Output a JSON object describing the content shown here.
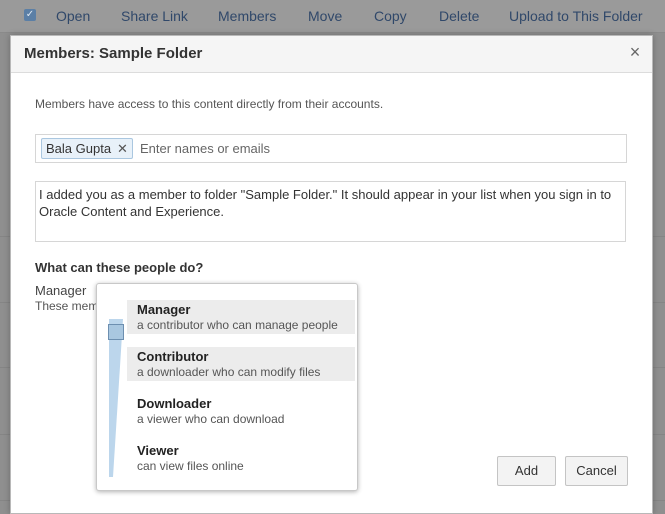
{
  "toolbar": {
    "items": [
      "Open",
      "Share Link",
      "Members",
      "Move",
      "Copy",
      "Delete",
      "Upload to This Folder"
    ]
  },
  "dialog": {
    "title": "Members: Sample Folder",
    "close_glyph": "×",
    "description": "Members have access to this content directly from their accounts.",
    "member_chip": "Bala Gupta",
    "chip_remove_glyph": "✕",
    "input_placeholder": "Enter names or emails",
    "message": "I added you as a member to folder \"Sample Folder.\" It should appear in your list when you sign in to Oracle Content and Experience.",
    "permissions_heading": "What can these people do?",
    "selected_role": "Manager",
    "role_help": "These mem",
    "add_label": "Add",
    "cancel_label": "Cancel"
  },
  "role_slider": {
    "selected_index": 0,
    "options": [
      {
        "title": "Manager",
        "subtitle": "a contributor who can manage people"
      },
      {
        "title": "Contributor",
        "subtitle": "a downloader who can modify files"
      },
      {
        "title": "Downloader",
        "subtitle": "a viewer who can download"
      },
      {
        "title": "Viewer",
        "subtitle": "can view files online"
      }
    ]
  },
  "colors": {
    "accent": "#5b7fa6",
    "highlight": "#ececec",
    "track": "#bcd6ec"
  },
  "icons": {
    "close": "close-icon",
    "chip_remove": "remove-chip-icon",
    "checkbox": "checkbox-checked-icon"
  }
}
